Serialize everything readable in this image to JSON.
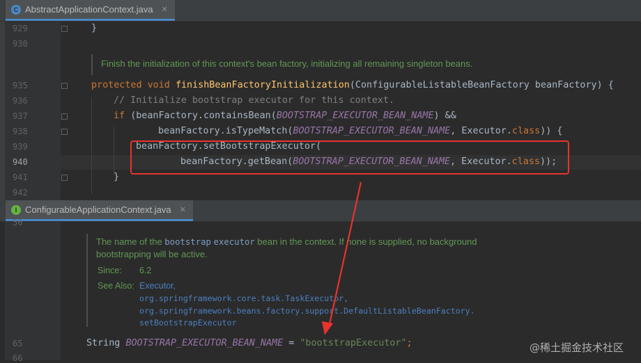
{
  "top_editor": {
    "tab": {
      "label": "AbstractApplicationContext.java",
      "close": "✕",
      "icon": "class-icon",
      "icon_glyph": "C"
    },
    "line_numbers": [
      "929",
      "930",
      "935",
      "936",
      "937",
      "938",
      "939",
      "940",
      "941",
      "942"
    ],
    "doc_comment": "Finish the initialization of this context's bean factory, initializing all remaining singleton beans.",
    "lines": {
      "l929": "}",
      "l935_kw": "protected void ",
      "l935_fn": "finishBeanFactoryInitialization",
      "l935_rest": "(ConfigurableListableBeanFactory beanFactory) {",
      "l936": "// Initialize bootstrap executor for this context.",
      "l937_kw": "if ",
      "l937_a": "(beanFactory.containsBean(",
      "l937_const": "BOOTSTRAP_EXECUTOR_BEAN_NAME",
      "l937_b": ") &&",
      "l938_a": "beanFactory.isTypeMatch(",
      "l938_const": "BOOTSTRAP_EXECUTOR_BEAN_NAME",
      "l938_b": ", Executor.",
      "l938_kw": "class",
      "l938_c": ")) {",
      "l939": "beanFactory.setBootstrapExecutor(",
      "l940_a": "beanFactory.getBean(",
      "l940_const": "BOOTSTRAP_EXECUTOR_BEAN_NAME",
      "l940_b": ", Executor.",
      "l940_kw": "class",
      "l940_c": "));",
      "l941": "}"
    }
  },
  "bottom_editor": {
    "tab": {
      "label": "ConfigurableApplicationContext.java",
      "close": "✕",
      "icon": "interface-icon",
      "icon_glyph": "I"
    },
    "line_numbers": [
      "56",
      "65",
      "66"
    ],
    "doc": {
      "line1_a": "The name of the ",
      "line1_code1": "bootstrap",
      "line1_code2": "executor",
      "line1_b": " bean in the context. If none is supplied, no background",
      "line2": "bootstrapping will be active.",
      "since_key": "Since:",
      "since_val": "6.2",
      "see_key": "See Also:",
      "see_links": [
        "Executor,",
        "org.springframework.core.task.TaskExecutor,",
        "org.springframework.beans.factory.support.DefaultListableBeanFactory.",
        "setBootstrapExecutor"
      ]
    },
    "code": {
      "type": "String ",
      "const": "BOOTSTRAP_EXECUTOR_BEAN_NAME",
      "eq": " = ",
      "str": "\"bootstrapExecutor\"",
      "end": ";"
    }
  },
  "watermark": "@稀土掘金技术社区",
  "colors": {
    "annotation": "#e8332d",
    "keyword": "#cc7832",
    "constant": "#9876aa",
    "string": "#6a8759",
    "doc": "#629755",
    "function": "#ffc66d"
  }
}
